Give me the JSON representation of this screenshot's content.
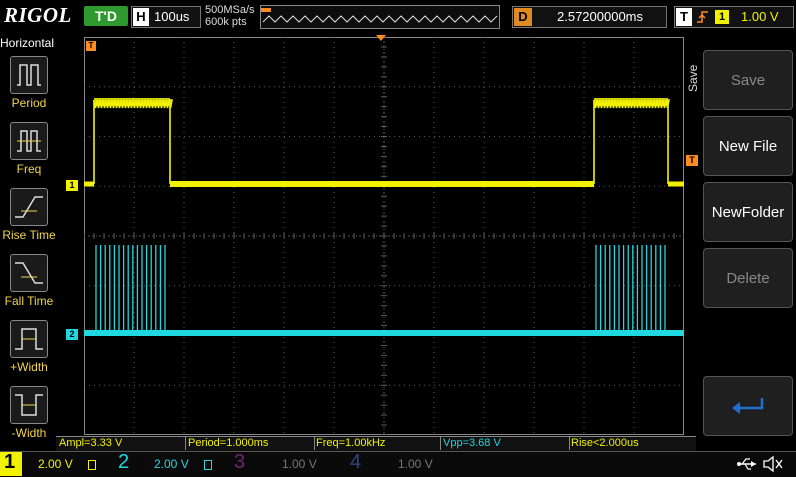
{
  "brand": "RIGOL",
  "status": {
    "trig_state": "T'D"
  },
  "horizontal_box": {
    "letter": "H",
    "timebase": "100us"
  },
  "acquisition": {
    "rate": "500MSa/s",
    "points": "600k pts"
  },
  "delay_box": {
    "letter": "D",
    "value": "2.57200000ms"
  },
  "trigger_box": {
    "letter": "T",
    "source": "1",
    "level": "1.00 V"
  },
  "left_menu": {
    "title": "Horizontal",
    "items": [
      {
        "label": "Period",
        "icon": "period-icon"
      },
      {
        "label": "Freq",
        "icon": "freq-icon"
      },
      {
        "label": "Rise Time",
        "icon": "rise-time-icon"
      },
      {
        "label": "Fall Time",
        "icon": "fall-time-icon"
      },
      {
        "label": "+Width",
        "icon": "pos-width-icon"
      },
      {
        "label": "-Width",
        "icon": "neg-width-icon"
      }
    ]
  },
  "right_menu": {
    "title": "Save",
    "buttons": [
      {
        "label": "Save",
        "enabled": false
      },
      {
        "label": "New File",
        "enabled": true
      },
      {
        "label": "NewFolder",
        "enabled": true
      },
      {
        "label": "Delete",
        "enabled": false
      }
    ],
    "enter_icon": "enter-return-icon"
  },
  "measurements": [
    {
      "text": "Ampl=3.33 V",
      "color": "#f2f200"
    },
    {
      "text": "Period=1.000ms",
      "color": "#f2f200"
    },
    {
      "text": "Freq=1.00kHz",
      "color": "#f2f200"
    },
    {
      "text": "Vpp=3.68 V",
      "color": "#1fd8e0"
    },
    {
      "text": "Rise<2.000us",
      "color": "#f2f200"
    }
  ],
  "channels": [
    {
      "num": "1",
      "scale": "2.00 V",
      "color": "#f2f200",
      "active": true
    },
    {
      "num": "2",
      "scale": "2.00 V",
      "color": "#1fd8e0",
      "active": true
    },
    {
      "num": "3",
      "scale": "1.00 V",
      "color": "#c23fc2",
      "active": false
    },
    {
      "num": "4",
      "scale": "1.00 V",
      "color": "#4a6cd8",
      "active": false
    }
  ],
  "markers": {
    "ch1": "1",
    "ch2": "2",
    "trigger": "T"
  },
  "colors": {
    "ch1": "#f2f200",
    "ch2": "#1fd8e0",
    "trigger": "#ff8a1f",
    "grid": "#5a5a5a",
    "accent": "#1e6fd0"
  },
  "icons": {
    "usb": "usb-icon",
    "speaker": "speaker-mute-icon",
    "enter": "enter-return-icon"
  }
}
